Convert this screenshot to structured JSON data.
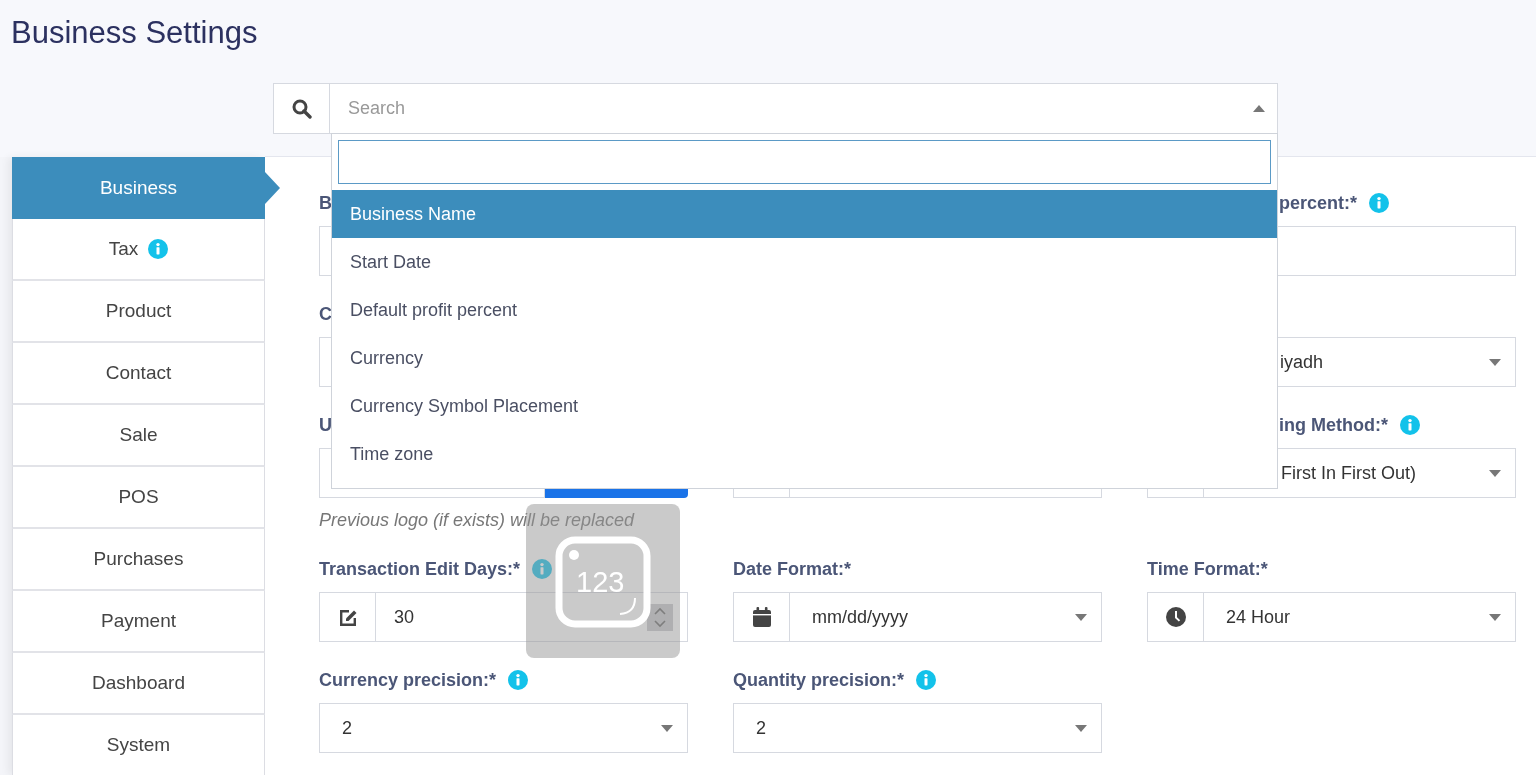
{
  "page": {
    "title": "Business Settings"
  },
  "search": {
    "placeholder": "Search",
    "expanded": true,
    "options": [
      {
        "label": "Business Name",
        "selected": true
      },
      {
        "label": "Start Date",
        "selected": false
      },
      {
        "label": "Default profit percent",
        "selected": false
      },
      {
        "label": "Currency",
        "selected": false
      },
      {
        "label": "Currency Symbol Placement",
        "selected": false
      },
      {
        "label": "Time zone",
        "selected": false
      }
    ]
  },
  "sidebar": {
    "items": [
      {
        "label": "Business",
        "selected": true,
        "info": false
      },
      {
        "label": "Tax",
        "selected": false,
        "info": true
      },
      {
        "label": "Product",
        "selected": false,
        "info": false
      },
      {
        "label": "Contact",
        "selected": false,
        "info": false
      },
      {
        "label": "Sale",
        "selected": false,
        "info": false
      },
      {
        "label": "POS",
        "selected": false,
        "info": false
      },
      {
        "label": "Purchases",
        "selected": false,
        "info": false
      },
      {
        "label": "Payment",
        "selected": false,
        "info": false
      },
      {
        "label": "Dashboard",
        "selected": false,
        "info": false
      },
      {
        "label": "System",
        "selected": false,
        "info": false
      }
    ]
  },
  "form": {
    "rows": [
      {
        "left": {
          "kind": "input",
          "label": "B"
        },
        "right": {
          "kind": "input",
          "label": "percent:*",
          "info": true
        }
      },
      {
        "left": {
          "kind": "input",
          "label": "C"
        },
        "right": {
          "kind": "select",
          "value": "iyadh"
        }
      },
      {
        "left": {
          "kind": "file",
          "label": "U",
          "help": "Previous logo (if exists) will be replaced"
        },
        "middle": {
          "kind": "addon-input"
        },
        "right": {
          "kind": "addon-select",
          "label": "ing Method:*",
          "info": true,
          "value": "First In First Out)"
        }
      },
      {
        "left": {
          "kind": "addon-number",
          "label": "Transaction Edit Days:*",
          "info": true,
          "value": "30"
        },
        "middle": {
          "kind": "addon-select",
          "label": "Date Format:*",
          "value": "mm/dd/yyyy"
        },
        "right": {
          "kind": "addon-select",
          "label": "Time Format:*",
          "value": "24 Hour"
        }
      },
      {
        "left": {
          "kind": "select",
          "label": "Currency precision:*",
          "info": true,
          "value": "2"
        },
        "middle": {
          "kind": "select",
          "label": "Quantity precision:*",
          "info": true,
          "value": "2"
        }
      }
    ]
  },
  "overlay": {
    "label": "123"
  }
}
